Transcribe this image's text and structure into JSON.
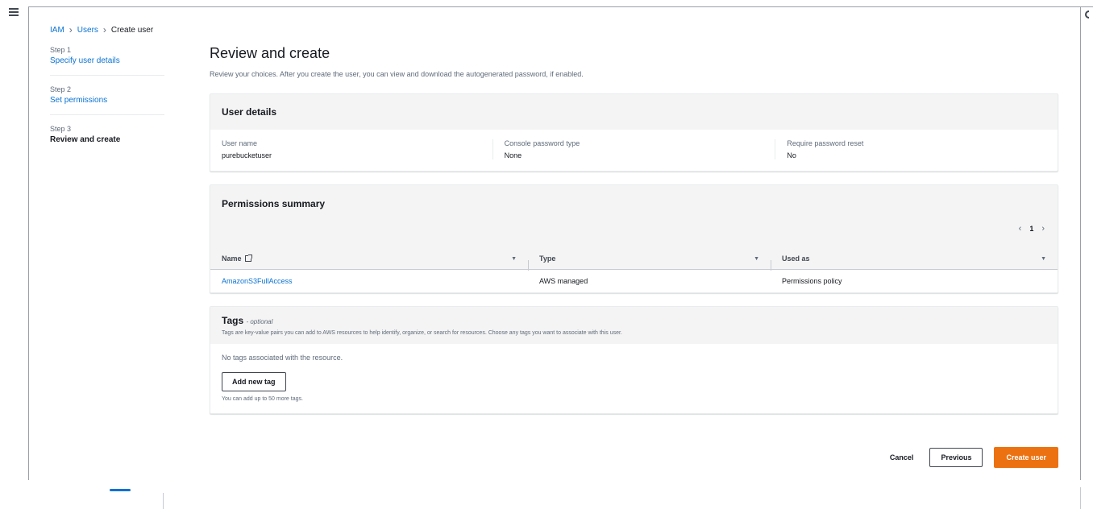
{
  "breadcrumb": {
    "root": "IAM",
    "users": "Users",
    "current": "Create user"
  },
  "steps": [
    {
      "label": "Step 1",
      "title": "Specify user details"
    },
    {
      "label": "Step 2",
      "title": "Set permissions"
    },
    {
      "label": "Step 3",
      "title": "Review and create"
    }
  ],
  "page": {
    "title": "Review and create",
    "description": "Review your choices. After you create the user, you can view and download the autogenerated password, if enabled."
  },
  "user_details": {
    "title": "User details",
    "fields": [
      {
        "key": "User name",
        "value": "purebucketuser"
      },
      {
        "key": "Console password type",
        "value": "None"
      },
      {
        "key": "Require password reset",
        "value": "No"
      }
    ]
  },
  "permissions": {
    "title": "Permissions summary",
    "page": "1",
    "columns": [
      "Name",
      "Type",
      "Used as"
    ],
    "rows": [
      {
        "name": "AmazonS3FullAccess",
        "type": "AWS managed",
        "used_as": "Permissions policy"
      }
    ]
  },
  "tags": {
    "title": "Tags",
    "optional": "- optional",
    "description": "Tags are key-value pairs you can add to AWS resources to help identify, organize, or search for resources. Choose any tags you want to associate with this user.",
    "empty": "No tags associated with the resource.",
    "add_button": "Add new tag",
    "hint": "You can add up to 50 more tags."
  },
  "actions": {
    "cancel": "Cancel",
    "previous": "Previous",
    "create": "Create user"
  },
  "colors": {
    "accent": "#0972d3",
    "primary_button": "#ec7211"
  },
  "icons": {
    "menu": "hamburger-menu-icon",
    "info": "info-icon",
    "external": "external-link-icon",
    "sort": "sort-caret-icon"
  }
}
